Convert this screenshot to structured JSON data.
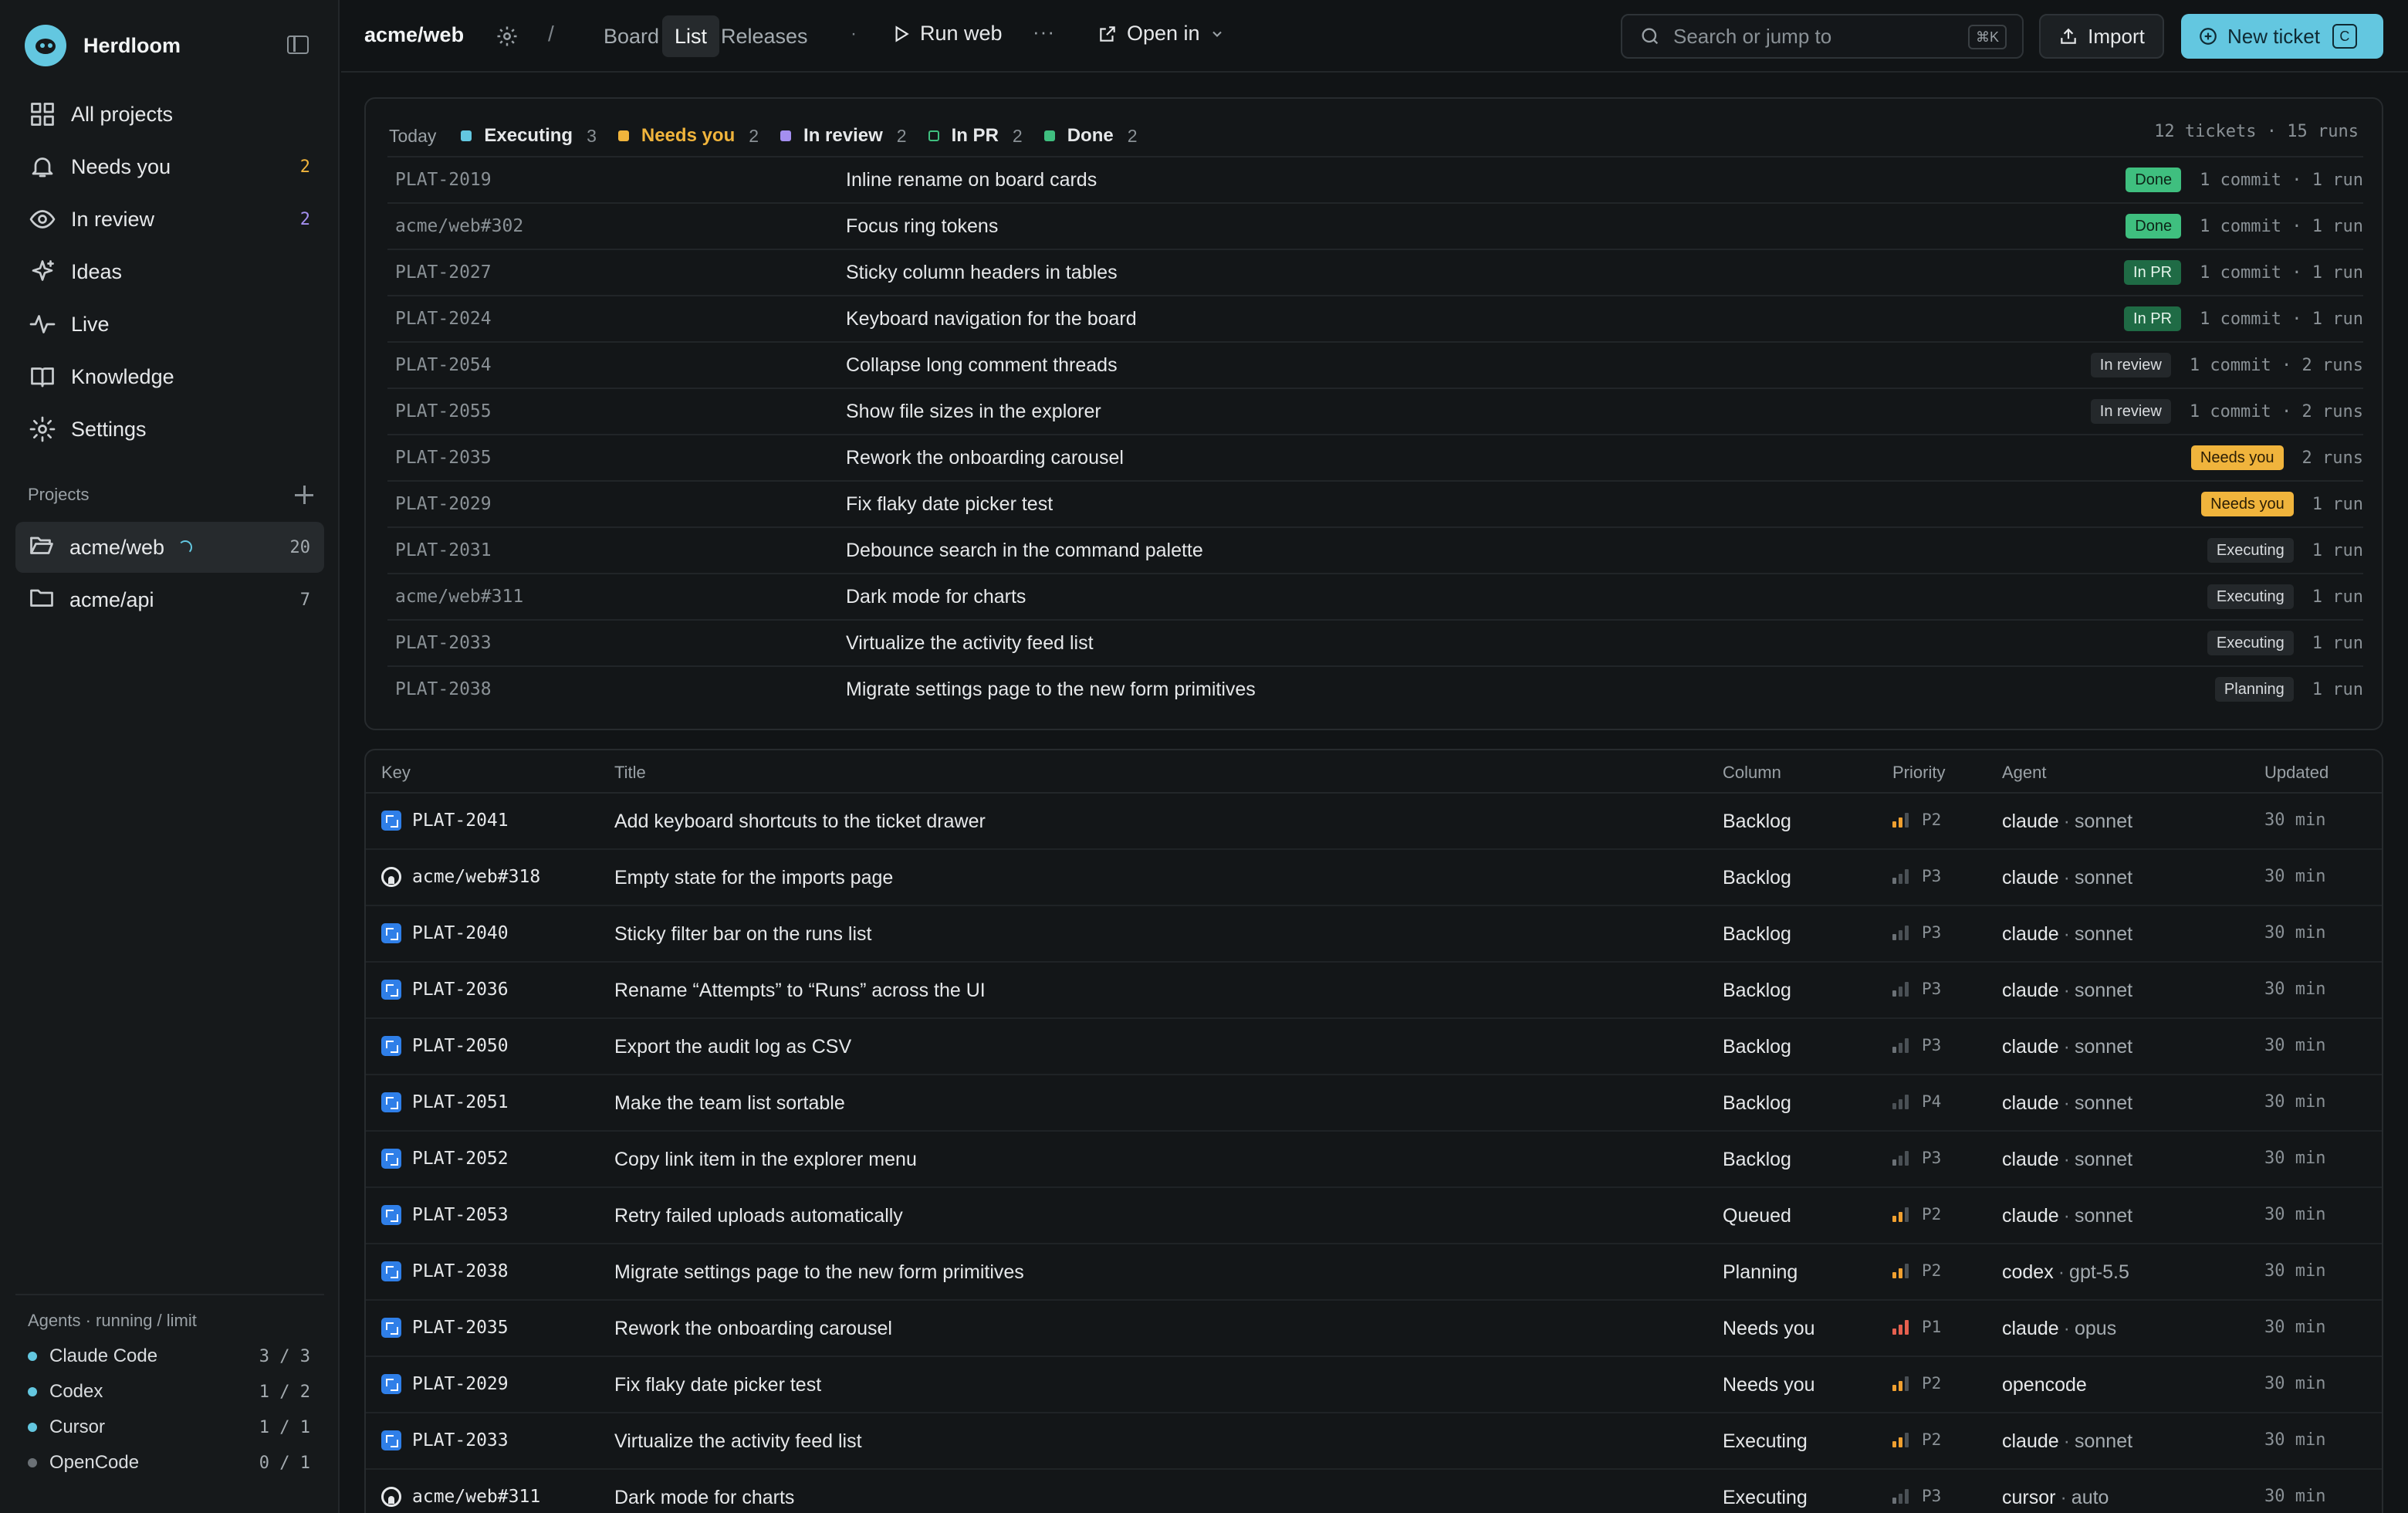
{
  "app": {
    "name": "Herdloom"
  },
  "sidebar": {
    "nav": [
      {
        "label": "All projects",
        "icon": "grid-icon"
      },
      {
        "label": "Needs you",
        "icon": "bell-icon",
        "count": "2",
        "count_color": "#f0b43c"
      },
      {
        "label": "In review",
        "icon": "eye-icon",
        "count": "2",
        "count_color": "#a48ff0"
      },
      {
        "label": "Ideas",
        "icon": "sparkle-icon"
      },
      {
        "label": "Live",
        "icon": "activity-icon"
      },
      {
        "label": "Knowledge",
        "icon": "book-icon"
      },
      {
        "label": "Settings",
        "icon": "gear-icon"
      }
    ],
    "projects_label": "Projects",
    "projects": [
      {
        "name": "acme/web",
        "count": "20",
        "active": true
      },
      {
        "name": "acme/api",
        "count": "7",
        "active": false
      }
    ],
    "agents_label": "Agents · running / limit",
    "agents": [
      {
        "name": "Claude Code",
        "usage": "3 / 3",
        "color": "#63c7e0"
      },
      {
        "name": "Codex",
        "usage": "1 / 2",
        "color": "#63c7e0"
      },
      {
        "name": "Cursor",
        "usage": "1 / 1",
        "color": "#63c7e0"
      },
      {
        "name": "OpenCode",
        "usage": "0 / 1",
        "color": "#6b7176"
      }
    ]
  },
  "topbar": {
    "project": "acme/web",
    "separator": "/",
    "tabs": [
      "Board",
      "List",
      "Releases"
    ],
    "active_tab": "List",
    "dot": "·",
    "run_label": "Run web",
    "more": "···",
    "open_in": "Open in",
    "search_placeholder": "Search or jump to",
    "search_shortcut": "⌘K",
    "import_label": "Import",
    "new_ticket_label": "New ticket",
    "new_ticket_shortcut": "C"
  },
  "today": {
    "label": "Today",
    "legend": [
      {
        "name": "Executing",
        "count": "3",
        "color": "#63c7e0",
        "text_color": "#e6e8ea"
      },
      {
        "name": "Needs you",
        "count": "2",
        "color": "#f0b43c",
        "text_color": "#f0b43c"
      },
      {
        "name": "In review",
        "count": "2",
        "color": "#a48ff0",
        "text_color": "#e6e8ea"
      },
      {
        "name": "In PR",
        "count": "2",
        "color": "transparent",
        "border": "#3fbf7f",
        "text_color": "#e6e8ea"
      },
      {
        "name": "Done",
        "count": "2",
        "color": "#3fbf7f",
        "text_color": "#e6e8ea"
      }
    ],
    "summary": "12 tickets · 15 runs",
    "rows": [
      {
        "key": "PLAT-2019",
        "title": "Inline rename on board cards",
        "status": "Done",
        "stats": "1 commit · 1 run"
      },
      {
        "key": "acme/web#302",
        "title": "Focus ring tokens",
        "status": "Done",
        "stats": "1 commit · 1 run"
      },
      {
        "key": "PLAT-2027",
        "title": "Sticky column headers in tables",
        "status": "In PR",
        "stats": "1 commit · 1 run"
      },
      {
        "key": "PLAT-2024",
        "title": "Keyboard navigation for the board",
        "status": "In PR",
        "stats": "1 commit · 1 run"
      },
      {
        "key": "PLAT-2054",
        "title": "Collapse long comment threads",
        "status": "In review",
        "stats": "1 commit · 2 runs"
      },
      {
        "key": "PLAT-2055",
        "title": "Show file sizes in the explorer",
        "status": "In review",
        "stats": "1 commit · 2 runs"
      },
      {
        "key": "PLAT-2035",
        "title": "Rework the onboarding carousel",
        "status": "Needs you",
        "stats": "2 runs"
      },
      {
        "key": "PLAT-2029",
        "title": "Fix flaky date picker test",
        "status": "Needs you",
        "stats": "1 run"
      },
      {
        "key": "PLAT-2031",
        "title": "Debounce search in the command palette",
        "status": "Executing",
        "stats": "1 run"
      },
      {
        "key": "acme/web#311",
        "title": "Dark mode for charts",
        "status": "Executing",
        "stats": "1 run"
      },
      {
        "key": "PLAT-2033",
        "title": "Virtualize the activity feed list",
        "status": "Executing",
        "stats": "1 run"
      },
      {
        "key": "PLAT-2038",
        "title": "Migrate settings page to the new form primitives",
        "status": "Planning",
        "stats": "1 run"
      }
    ]
  },
  "table": {
    "columns": [
      "Key",
      "Title",
      "Column",
      "Priority",
      "Agent",
      "Updated"
    ],
    "rows": [
      {
        "source": "jira",
        "key": "PLAT-2041",
        "title": "Add keyboard shortcuts to the ticket drawer",
        "column": "Backlog",
        "priority": "P2",
        "agent": "claude",
        "model": "sonnet",
        "updated": "30 min"
      },
      {
        "source": "github",
        "key": "acme/web#318",
        "title": "Empty state for the imports page",
        "column": "Backlog",
        "priority": "P3",
        "agent": "claude",
        "model": "sonnet",
        "updated": "30 min"
      },
      {
        "source": "jira",
        "key": "PLAT-2040",
        "title": "Sticky filter bar on the runs list",
        "column": "Backlog",
        "priority": "P3",
        "agent": "claude",
        "model": "sonnet",
        "updated": "30 min"
      },
      {
        "source": "jira",
        "key": "PLAT-2036",
        "title": "Rename “Attempts” to “Runs” across the UI",
        "column": "Backlog",
        "priority": "P3",
        "agent": "claude",
        "model": "sonnet",
        "updated": "30 min"
      },
      {
        "source": "jira",
        "key": "PLAT-2050",
        "title": "Export the audit log as CSV",
        "column": "Backlog",
        "priority": "P3",
        "agent": "claude",
        "model": "sonnet",
        "updated": "30 min"
      },
      {
        "source": "jira",
        "key": "PLAT-2051",
        "title": "Make the team list sortable",
        "column": "Backlog",
        "priority": "P4",
        "agent": "claude",
        "model": "sonnet",
        "updated": "30 min"
      },
      {
        "source": "jira",
        "key": "PLAT-2052",
        "title": "Copy link item in the explorer menu",
        "column": "Backlog",
        "priority": "P3",
        "agent": "claude",
        "model": "sonnet",
        "updated": "30 min"
      },
      {
        "source": "jira",
        "key": "PLAT-2053",
        "title": "Retry failed uploads automatically",
        "column": "Queued",
        "priority": "P2",
        "agent": "claude",
        "model": "sonnet",
        "updated": "30 min"
      },
      {
        "source": "jira",
        "key": "PLAT-2038",
        "title": "Migrate settings page to the new form primitives",
        "column": "Planning",
        "priority": "P2",
        "agent": "codex",
        "model": "gpt-5.5",
        "updated": "30 min"
      },
      {
        "source": "jira",
        "key": "PLAT-2035",
        "title": "Rework the onboarding carousel",
        "column": "Needs you",
        "priority": "P1",
        "agent": "claude",
        "model": "opus",
        "updated": "30 min"
      },
      {
        "source": "jira",
        "key": "PLAT-2029",
        "title": "Fix flaky date picker test",
        "column": "Needs you",
        "priority": "P2",
        "agent": "opencode",
        "model": "",
        "updated": "30 min"
      },
      {
        "source": "jira",
        "key": "PLAT-2033",
        "title": "Virtualize the activity feed list",
        "column": "Executing",
        "priority": "P2",
        "agent": "claude",
        "model": "sonnet",
        "updated": "30 min"
      },
      {
        "source": "github",
        "key": "acme/web#311",
        "title": "Dark mode for charts",
        "column": "Executing",
        "priority": "P3",
        "agent": "cursor",
        "model": "auto",
        "updated": "30 min"
      }
    ]
  },
  "status_styles": {
    "Done": {
      "bg": "#3fbf7f",
      "fg": "#0d2417"
    },
    "In PR": {
      "bg": "#1f6b45",
      "fg": "#e6f5ec"
    },
    "In review": {
      "bg": "#24282b",
      "fg": "#d9dcdf"
    },
    "Needs you": {
      "bg": "#f0b43c",
      "fg": "#2a1d05"
    },
    "Executing": {
      "bg": "#24282b",
      "fg": "#d9dcdf"
    },
    "Planning": {
      "bg": "#24282b",
      "fg": "#d9dcdf"
    }
  },
  "priority_colors": {
    "P1": "#e5604f",
    "P2": "#f0a030",
    "P3": "#6b7176",
    "P4": "#6b7176"
  }
}
